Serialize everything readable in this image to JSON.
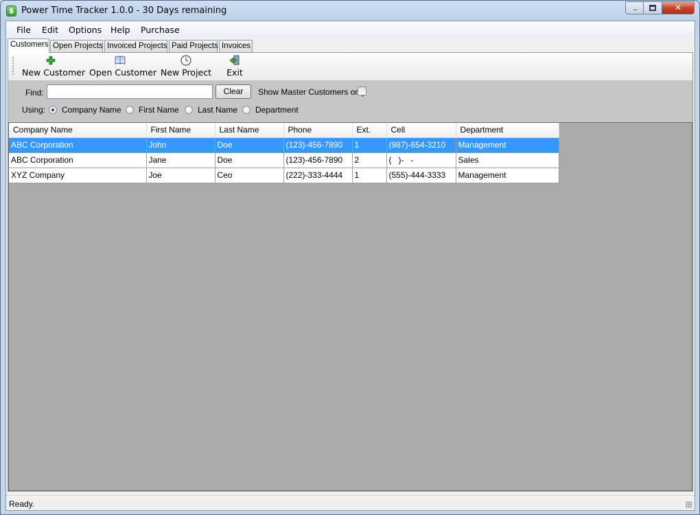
{
  "window": {
    "title": "Power Time Tracker 1.0.0 - 30 Days remaining",
    "app_icon_glyph": "$"
  },
  "menu": [
    "File",
    "Edit",
    "Options",
    "Help",
    "Purchase"
  ],
  "tabs": [
    "Customers",
    "Open Projects",
    "Invoiced Projects",
    "Paid Projects",
    "Invoices"
  ],
  "active_tab": "Customers",
  "toolbar": {
    "new_customer": "New Customer",
    "open_customer": "Open Customer",
    "new_project": "New Project",
    "exit": "Exit"
  },
  "search": {
    "find_label": "Find:",
    "find_value": "",
    "clear_label": "Clear",
    "master_label": "Show Master Customers only",
    "master_checked": false,
    "using_label": "Using:",
    "options": [
      "Company Name",
      "First Name",
      "Last Name",
      "Department"
    ],
    "selected_option": "Company Name"
  },
  "grid": {
    "columns": [
      "Company Name",
      "First Name",
      "Last Name",
      "Phone",
      "Ext.",
      "Cell",
      "Department"
    ],
    "rows": [
      [
        "ABC Corporation",
        "John",
        "Doe",
        "(123)-456-7890",
        "1",
        "(987)-654-3210",
        "Management"
      ],
      [
        "ABC Corporation",
        "Jane",
        "Doe",
        "(123)-456-7890",
        "2",
        "(   )-   -",
        "Sales"
      ],
      [
        "XYZ Company",
        "Joe",
        "Ceo",
        "(222)-333-4444",
        "1",
        "(555)-444-3333",
        "Management"
      ]
    ],
    "selected_row": 0
  },
  "status": "Ready.",
  "colors": {
    "selection": "#3399ff",
    "grid_background": "#ababab",
    "search_panel": "#c6c6c6"
  }
}
